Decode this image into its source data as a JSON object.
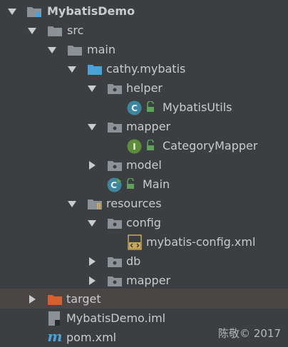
{
  "tree": {
    "root": "MybatisDemo",
    "src": "src",
    "main": "main",
    "package": "cathy.mybatis",
    "helper": "helper",
    "mybatis_utils": "MybatisUtils",
    "mapper_pkg": "mapper",
    "category_mapper": "CategoryMapper",
    "model": "model",
    "main_class": "Main",
    "resources": "resources",
    "config": "config",
    "mybatis_config": "mybatis-config.xml",
    "db": "db",
    "mapper_res": "mapper",
    "target": "target",
    "iml": "MybatisDemo.iml",
    "pom": "pom.xml"
  },
  "badges": {
    "class_letter": "C",
    "interface_letter": "I",
    "maven_letter": "m"
  },
  "watermark": "陈敬© 2017",
  "colors": {
    "background": "#3c3f41",
    "text": "#c9cbcd",
    "folder": "#8a9298",
    "source_folder": "#4aa2d8",
    "target_folder": "#d6612f",
    "class_badge": "#3e86a0",
    "interface_badge": "#5e8c3a",
    "selected_row": "#4b4646"
  }
}
